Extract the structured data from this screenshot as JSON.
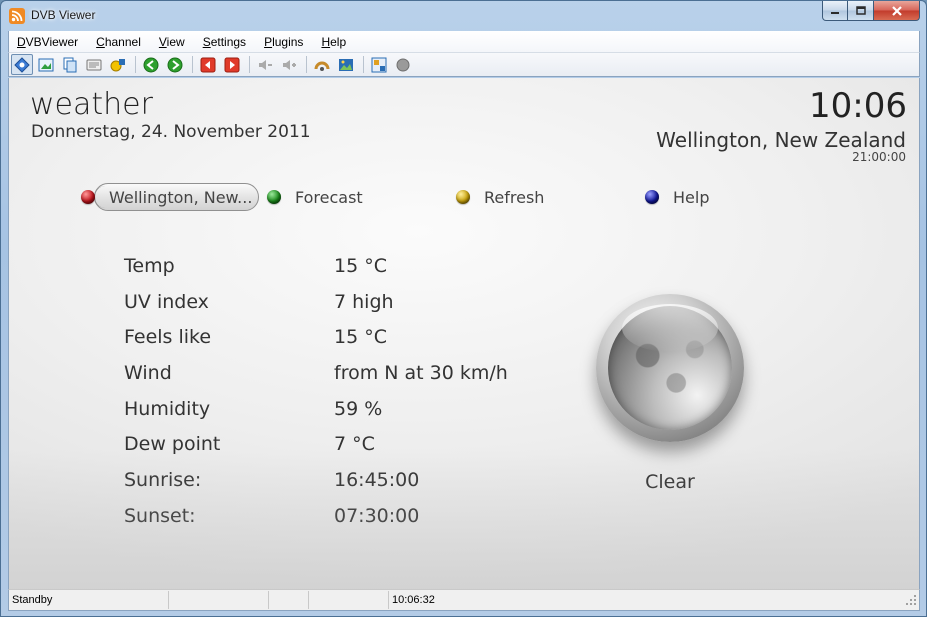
{
  "window": {
    "title": "DVB Viewer",
    "caption_icons": [
      "minimize-icon",
      "maximize-icon",
      "close-icon"
    ]
  },
  "menubar": {
    "items": [
      {
        "first": "D",
        "rest": "VBViewer"
      },
      {
        "first": "C",
        "rest": "hannel"
      },
      {
        "first": "V",
        "rest": "iew"
      },
      {
        "first": "S",
        "rest": "ettings"
      },
      {
        "first": "P",
        "rest": "lugins"
      },
      {
        "first": "H",
        "rest": "elp"
      }
    ]
  },
  "toolbar": {
    "icons": [
      "osd-icon",
      "picture-icon",
      "copy-icon",
      "teletext-icon",
      "epg-icon",
      "back-icon",
      "forward-icon",
      "prev-channel-icon",
      "next-channel-icon",
      "volume-down-icon",
      "volume-up-icon",
      "recorder-icon",
      "image-icon",
      "settings-icon",
      "record-icon"
    ]
  },
  "osd": {
    "title": "weather",
    "date": "Donnerstag, 24. November 2011",
    "clock": "10:06",
    "location": "Wellington, New Zealand",
    "local_time": "21:00:00",
    "nav": {
      "red_label": "Wellington, New...",
      "green_label": "Forecast",
      "yellow_label": "Refresh",
      "blue_label": "Help"
    },
    "colors": {
      "red": "#c0141c",
      "green": "#1a8a1a",
      "yellow": "#c9a20a",
      "blue": "#10169a"
    },
    "weather": [
      {
        "label": "Temp",
        "value": "15 °C"
      },
      {
        "label": "UV index",
        "value": "7 high"
      },
      {
        "label": "Feels like",
        "value": "15 °C"
      },
      {
        "label": "Wind",
        "value": "from N at 30 km/h"
      },
      {
        "label": "Humidity",
        "value": "59 %"
      },
      {
        "label": "Dew point",
        "value": "7 °C"
      },
      {
        "label": "Sunrise:",
        "value": "16:45:00"
      },
      {
        "label": "Sunset:",
        "value": "07:30:00"
      }
    ],
    "condition_icon": "moon-clear-night-icon",
    "condition": "Clear"
  },
  "statusbar": {
    "status": "Standby",
    "time": "10:06:32"
  }
}
